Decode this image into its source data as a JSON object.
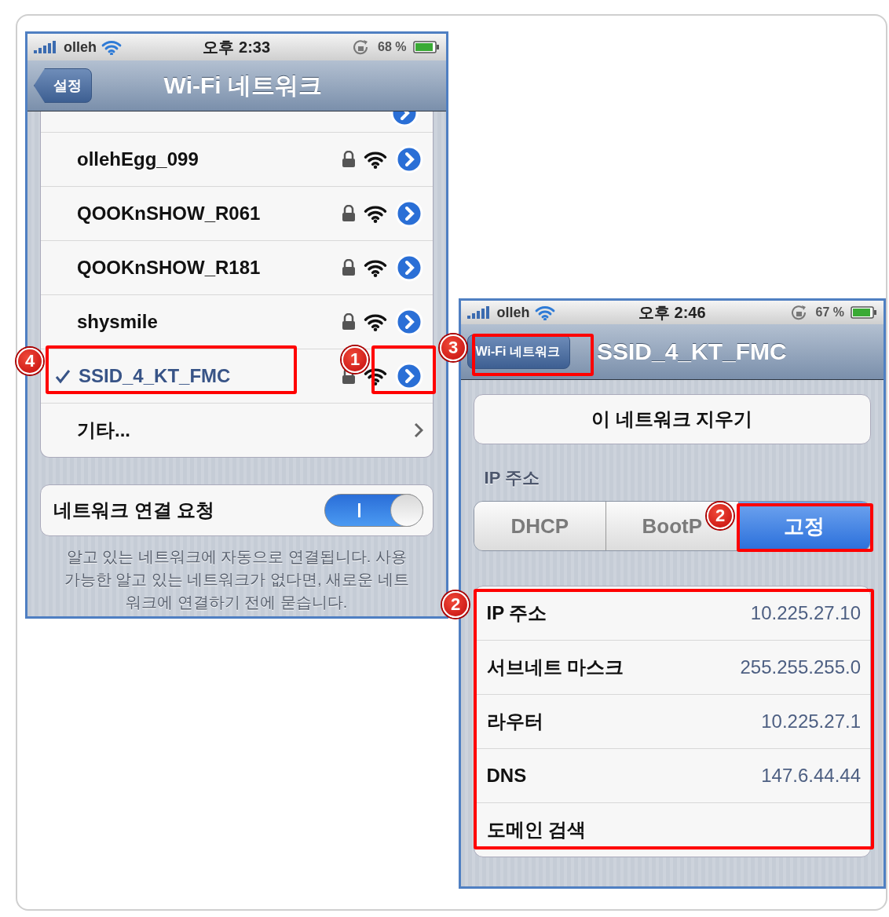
{
  "left_screen": {
    "status_bar": {
      "carrier": "olleh",
      "time": "오후 2:33",
      "battery": "68 %"
    },
    "nav_bar": {
      "back": "설정",
      "title": "Wi-Fi 네트워크"
    },
    "networks": [
      {
        "name": "ollehEgg_099",
        "locked": true,
        "selected": false
      },
      {
        "name": "QOOKnSHOW_R061",
        "locked": true,
        "selected": false
      },
      {
        "name": "QOOKnSHOW_R181",
        "locked": true,
        "selected": false
      },
      {
        "name": "shysmile",
        "locked": true,
        "selected": false
      },
      {
        "name": "SSID_4_KT_FMC",
        "locked": true,
        "selected": true
      }
    ],
    "other": "기타...",
    "ask_to_join": {
      "label": "네트워크 연결 요청",
      "on": true
    },
    "footer": "알고 있는 네트워크에 자동으로 연결됩니다. 사용 가능한 알고 있는 네트워크가 없다면, 새로운 네트워크에 연결하기 전에 묻습니다."
  },
  "right_screen": {
    "status_bar": {
      "carrier": "olleh",
      "time": "오후 2:46",
      "battery": "67 %"
    },
    "nav_bar": {
      "back": "Wi-Fi 네트워크",
      "title": "SSID_4_KT_FMC"
    },
    "forget_button": "이 네트워크 지우기",
    "section_label": "IP 주소",
    "segments": [
      {
        "label": "DHCP",
        "selected": false
      },
      {
        "label": "BootP",
        "selected": false
      },
      {
        "label": "고정",
        "selected": true
      }
    ],
    "fields": [
      {
        "label": "IP 주소",
        "value": "10.225.27.10"
      },
      {
        "label": "서브네트 마스크",
        "value": "255.255.255.0"
      },
      {
        "label": "라우터",
        "value": "10.225.27.1"
      },
      {
        "label": "DNS",
        "value": "147.6.44.44"
      },
      {
        "label": "도메인 검색"
      }
    ]
  },
  "badges": [
    {
      "number": "4"
    },
    {
      "number": "1"
    },
    {
      "number": "3"
    },
    {
      "number": "2"
    },
    {
      "number": "2"
    }
  ]
}
